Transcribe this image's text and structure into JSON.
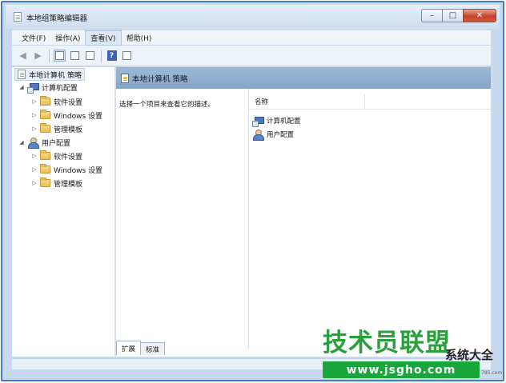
{
  "window": {
    "title": "本地组策略编辑器",
    "buttons": {
      "minimize": "–",
      "maximize": "□",
      "close": "✕"
    }
  },
  "menu": [
    "文件(F)",
    "操作(A)",
    "查看(V)",
    "帮助(H)"
  ],
  "toolbar": {
    "back_icon": "back-arrow-icon",
    "forward_icon": "forward-arrow-icon",
    "help_glyph": "?"
  },
  "tree": {
    "root": "本地计算机 策略",
    "computer": {
      "label": "计算机配置",
      "children": [
        "软件设置",
        "Windows 设置",
        "管理模板"
      ]
    },
    "user": {
      "label": "用户配置",
      "children": [
        "软件设置",
        "Windows 设置",
        "管理模板"
      ]
    }
  },
  "content": {
    "header": "本地计算机 策略",
    "description": "选择一个项目来查看它的描述。",
    "column_name": "名称",
    "items": [
      "计算机配置",
      "用户配置"
    ]
  },
  "tabs": [
    "扩展",
    "标准"
  ],
  "watermark": {
    "brand": "技术员联盟",
    "suffix": "系统大全",
    "url": "www.jsgho.com",
    "tiny": "785.com"
  },
  "colors": {
    "accent": "#3d7ec9",
    "header": "#86a4c6",
    "watermark": "#19a63b"
  }
}
